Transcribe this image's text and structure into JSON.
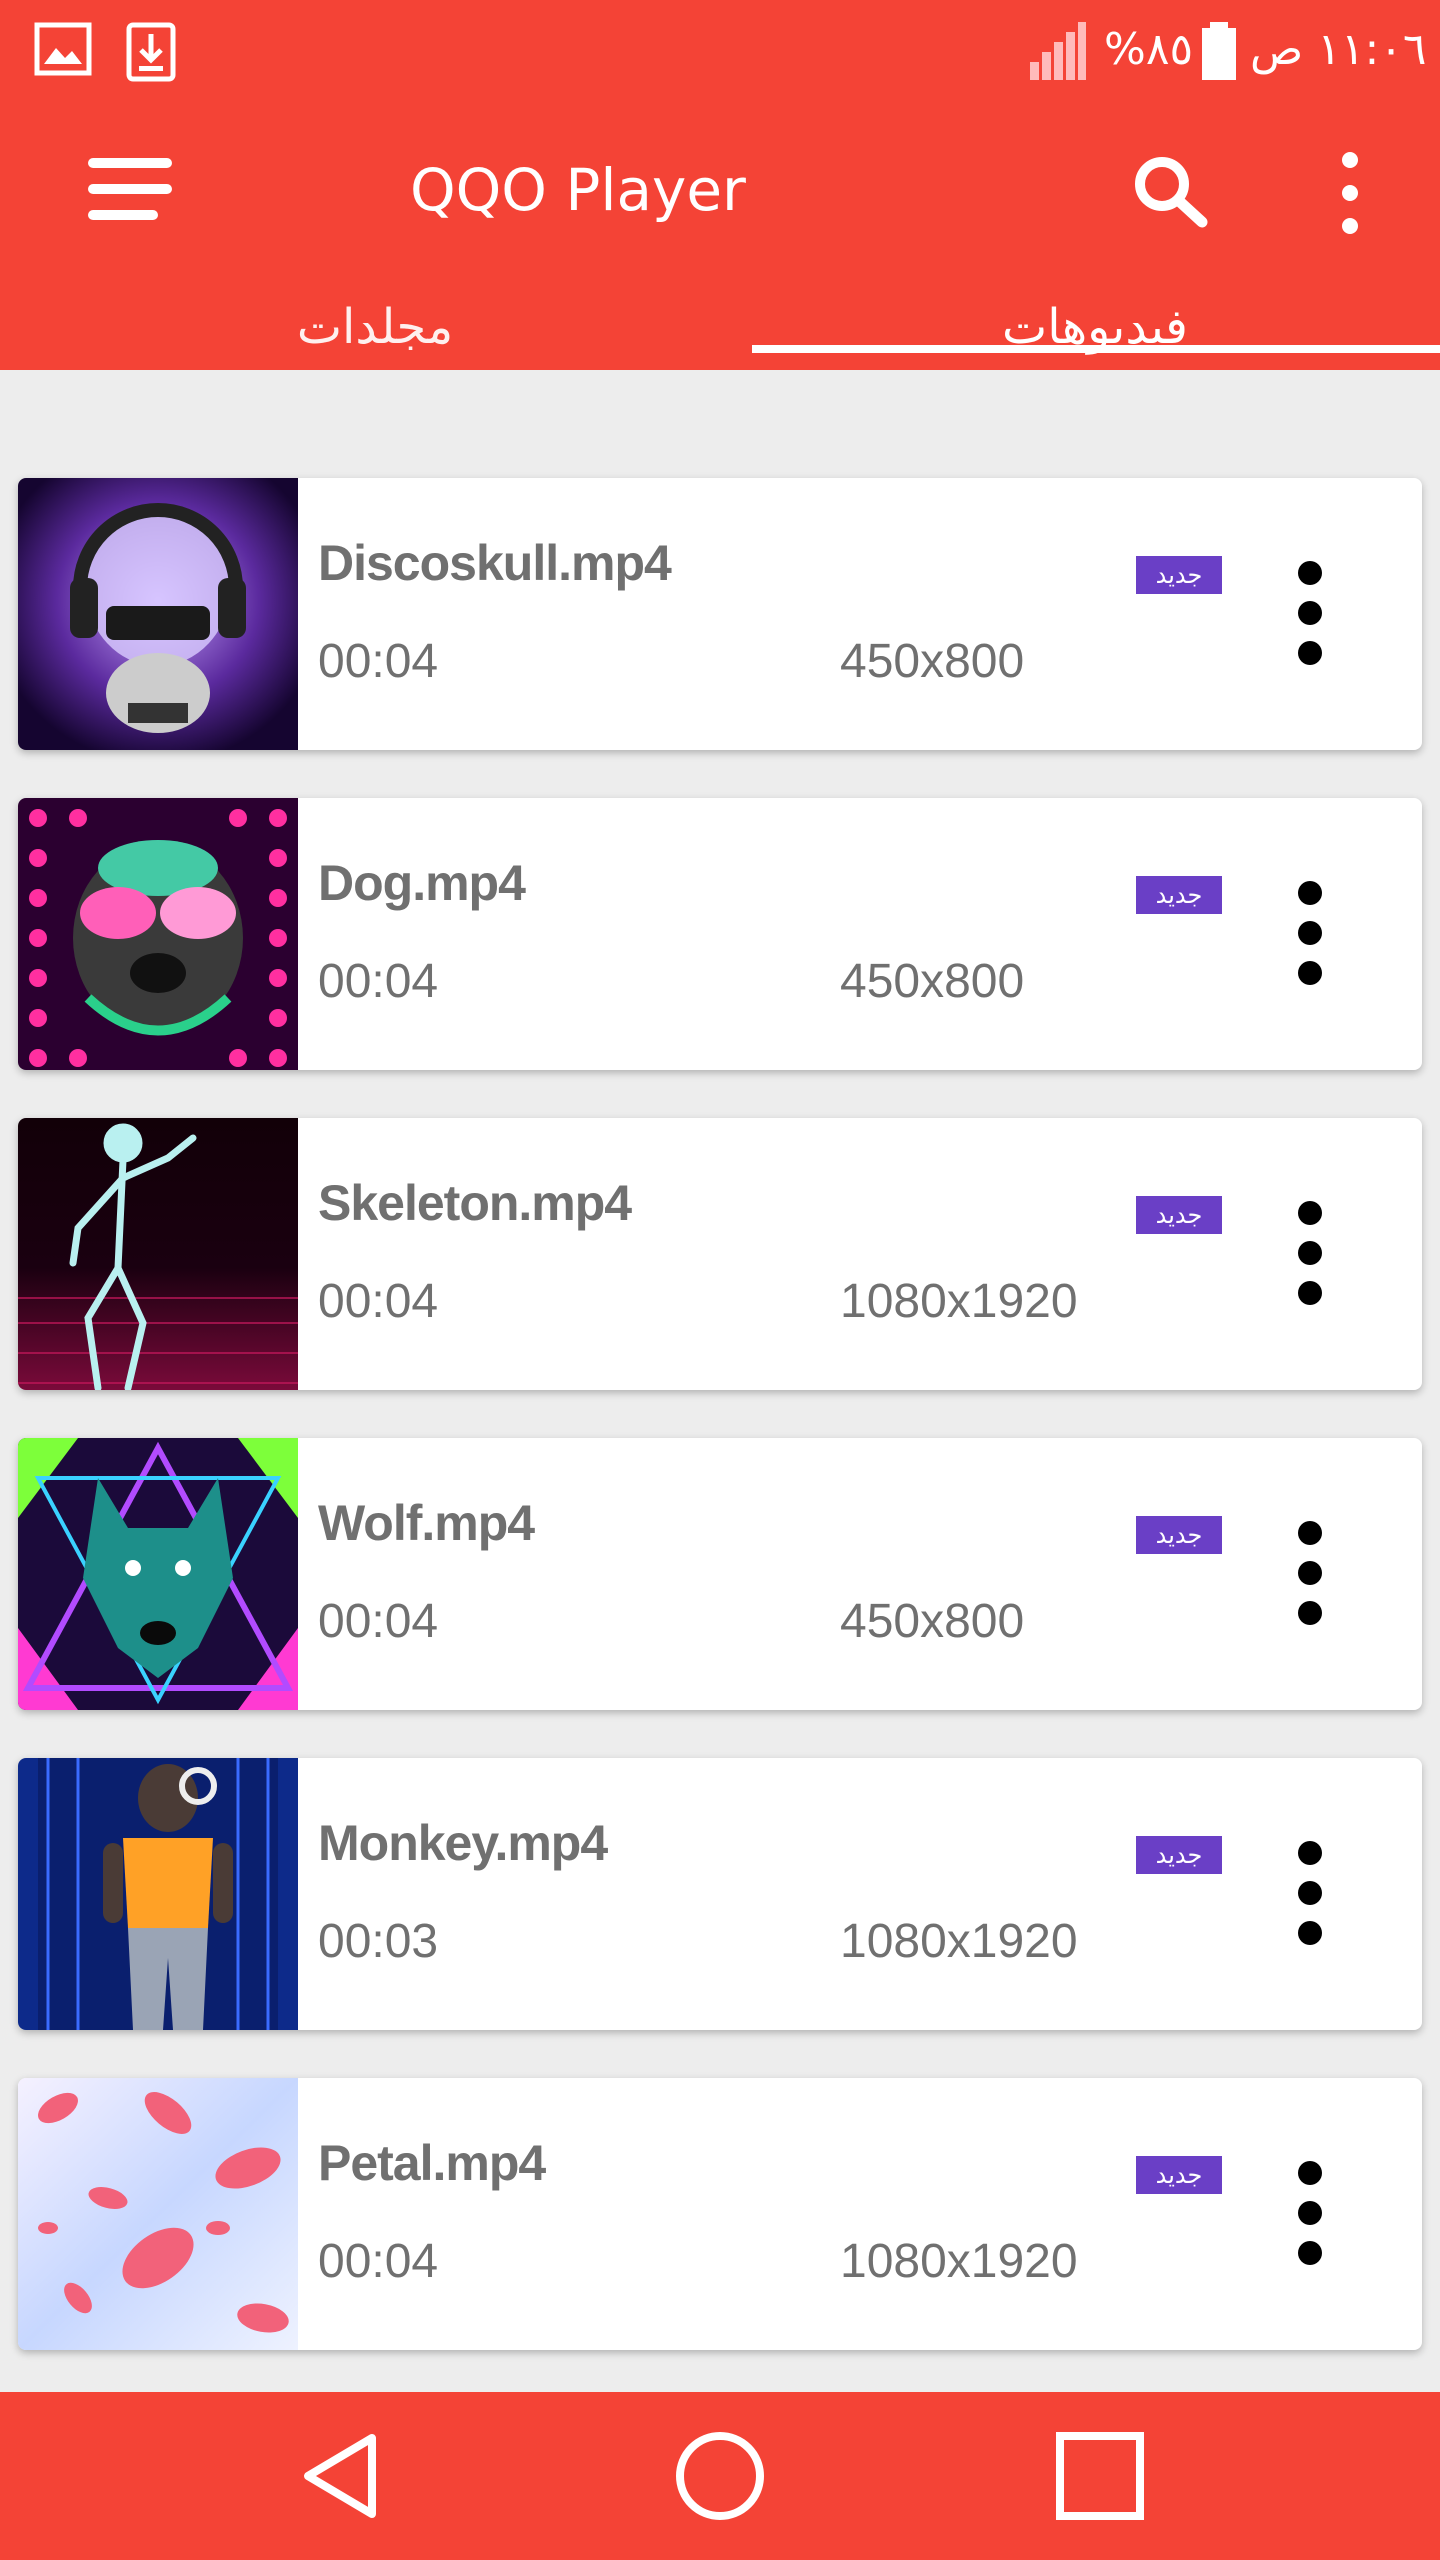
{
  "status_bar": {
    "time": "١١:٠٦ ص",
    "battery_text": "%٨٥",
    "icons": [
      "gallery-icon",
      "download-icon",
      "signal-icon",
      "battery-icon"
    ]
  },
  "app_bar": {
    "title": "QQO Player",
    "icons": [
      "menu-icon",
      "search-icon",
      "overflow-menu-icon"
    ]
  },
  "tabs": [
    {
      "label": "مجلدات",
      "selected": false
    },
    {
      "label": "فيديوهات",
      "selected": true
    }
  ],
  "videos": [
    {
      "name": "Discoskull.mp4",
      "duration": "00:04",
      "resolution": "450x800",
      "badge": "جديد"
    },
    {
      "name": "Dog.mp4",
      "duration": "00:04",
      "resolution": "450x800",
      "badge": "جديد"
    },
    {
      "name": "Skeleton.mp4",
      "duration": "00:04",
      "resolution": "1080x1920",
      "badge": "جديد"
    },
    {
      "name": "Wolf.mp4",
      "duration": "00:04",
      "resolution": "450x800",
      "badge": "جديد"
    },
    {
      "name": "Monkey.mp4",
      "duration": "00:03",
      "resolution": "1080x1920",
      "badge": "جديد"
    },
    {
      "name": "Petal.mp4",
      "duration": "00:04",
      "resolution": "1080x1920",
      "badge": "جديد"
    }
  ],
  "nav": {
    "icons": [
      "back-icon",
      "home-icon",
      "recents-icon"
    ]
  },
  "colors": {
    "primary": "#f44336",
    "badge": "#6a3fc6",
    "text_secondary": "#707070"
  }
}
